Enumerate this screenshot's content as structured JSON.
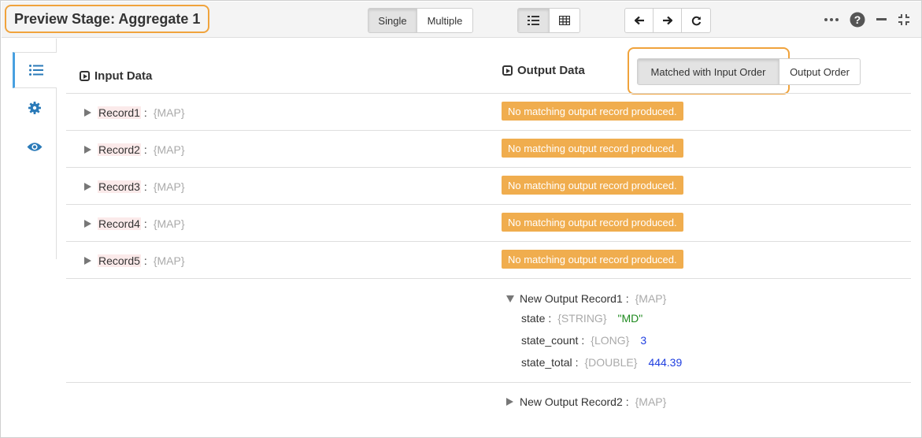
{
  "header": {
    "title": "Preview Stage: Aggregate 1",
    "view_mode": {
      "single": "Single",
      "multiple": "Multiple",
      "selected": "Single"
    },
    "layout_icons": [
      "list-view-icon",
      "table-view-icon"
    ],
    "nav_icons": [
      "arrow-left-icon",
      "arrow-right-icon",
      "refresh-icon"
    ],
    "window_icons": [
      "more-icon",
      "help-icon",
      "minimize-icon",
      "fullscreen-icon"
    ]
  },
  "sidebar": {
    "tabs": [
      "list-icon",
      "gear-icon",
      "eye-icon"
    ],
    "active": "list-icon"
  },
  "input": {
    "title": "Input Data",
    "records": [
      {
        "name": "Record1",
        "type": "{MAP}"
      },
      {
        "name": "Record2",
        "type": "{MAP}"
      },
      {
        "name": "Record3",
        "type": "{MAP}"
      },
      {
        "name": "Record4",
        "type": "{MAP}"
      },
      {
        "name": "Record5",
        "type": "{MAP}"
      }
    ]
  },
  "output": {
    "title": "Output Data",
    "order": {
      "matched": "Matched with Input Order",
      "output": "Output Order",
      "selected": "matched"
    },
    "no_match": [
      "No matching output record produced.",
      "No matching output record produced.",
      "No matching output record produced.",
      "No matching output record produced.",
      "No matching output record produced."
    ],
    "new_records": [
      {
        "name": "New Output Record1",
        "type": "{MAP}",
        "expanded": true,
        "fields": [
          {
            "key": "state",
            "type": "{STRING}",
            "value": "\"MD\"",
            "kind": "string"
          },
          {
            "key": "state_count",
            "type": "{LONG}",
            "value": "3",
            "kind": "number"
          },
          {
            "key": "state_total",
            "type": "{DOUBLE}",
            "value": "444.39",
            "kind": "number"
          }
        ]
      },
      {
        "name": "New Output Record2",
        "type": "{MAP}",
        "expanded": false
      }
    ]
  },
  "colors": {
    "highlight": "#f0a33c",
    "badge": "#f0ad4e",
    "accent": "#48a0e0",
    "string_value": "#1e8a1e",
    "number_value": "#1f3fe0"
  }
}
